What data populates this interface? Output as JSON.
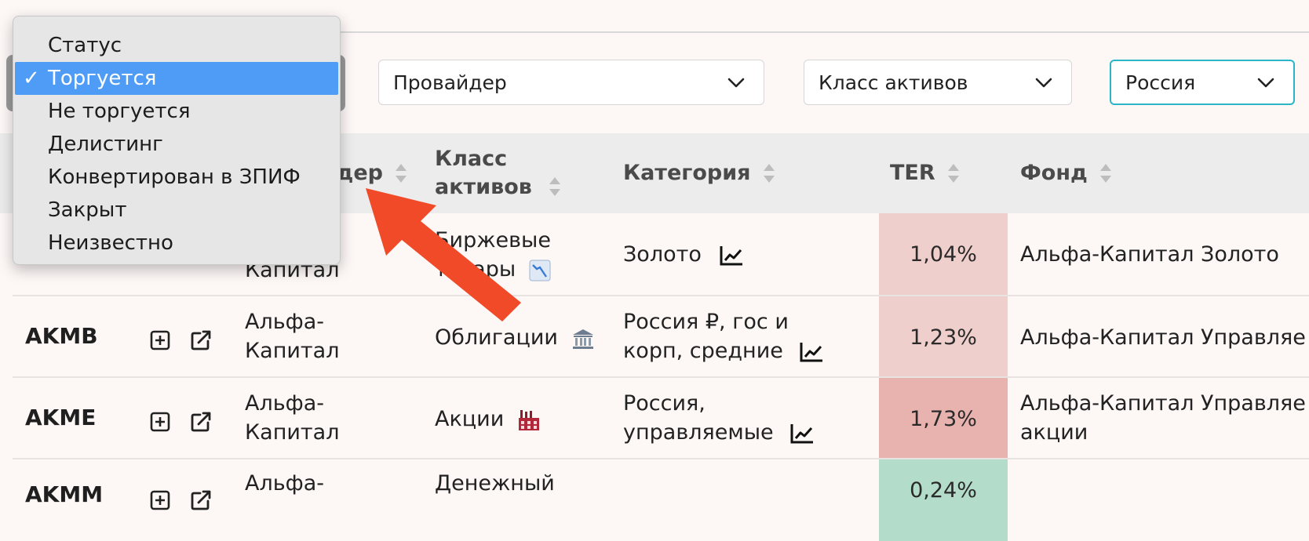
{
  "filters": {
    "status_options": [
      "Статус",
      "Торгуется",
      "Не торгуется",
      "Делистинг",
      "Конвертирован в ЗПИФ",
      "Закрыт",
      "Неизвестно"
    ],
    "status_selected_index": 1,
    "status_check": "✓",
    "provider": "Провайдер",
    "asset_class": "Класс активов",
    "country": "Россия"
  },
  "table": {
    "headers": {
      "provider": "Провайдер",
      "provider_visible": "дер",
      "asset_class": "Класс активов",
      "category": "Категория",
      "ter": "TER",
      "fund": "Фонд"
    },
    "rows": [
      {
        "ticker": "",
        "provider": "Капитал",
        "asset_class": "Биржевые товары",
        "category": "Золото",
        "ter": "1,04%",
        "fund": "Альфа-Капитал Золото"
      },
      {
        "ticker": "AKMB",
        "provider": "Альфа-Капитал",
        "asset_class": "Облигации",
        "category": "Россия ₽, гос и корп, средние",
        "ter": "1,23%",
        "fund": "Альфа-Капитал Управляе"
      },
      {
        "ticker": "AKME",
        "provider": "Альфа-Капитал",
        "asset_class": "Акции",
        "category": "Россия, управляемые",
        "ter": "1,73%",
        "fund": "Альфа-Капитал Управляе акции"
      },
      {
        "ticker": "AKMM",
        "provider": "Альфа-",
        "asset_class": "Денежный",
        "category": "",
        "ter": "0,24%",
        "fund": ""
      }
    ]
  },
  "colors": {
    "accent_focus": "#2bb6c8",
    "selected_option": "#4f9cf7",
    "ter_low": "#efcfcc",
    "ter_mid": "#efcfcc",
    "ter_high": "#e8b3ae",
    "ter_good": "#b3dccb",
    "arrow": "#f04a28"
  },
  "icons": {
    "add": "plus-square-icon",
    "external": "external-link-icon",
    "chart": "line-chart-icon",
    "commodities": "chart-decreasing-icon",
    "bonds": "classical-building-icon",
    "stocks": "factory-icon",
    "chevron": "chevron-down-icon",
    "sort": "sort-icon"
  }
}
